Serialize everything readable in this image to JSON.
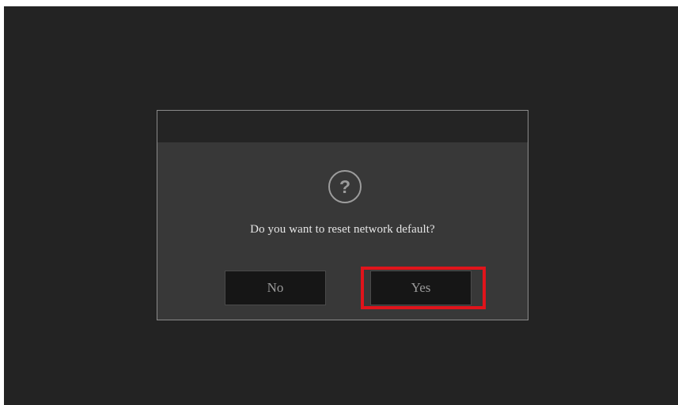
{
  "dialog": {
    "icon": "question-icon",
    "icon_glyph": "?",
    "message": "Do you want to reset network default?",
    "no_label": "No",
    "yes_label": "Yes"
  },
  "colors": {
    "background": "#232323",
    "dialog_body": "#383838",
    "dialog_header": "#242424",
    "button_bg": "#161616",
    "highlight": "#e0141b",
    "text": "#e6e6e6"
  }
}
